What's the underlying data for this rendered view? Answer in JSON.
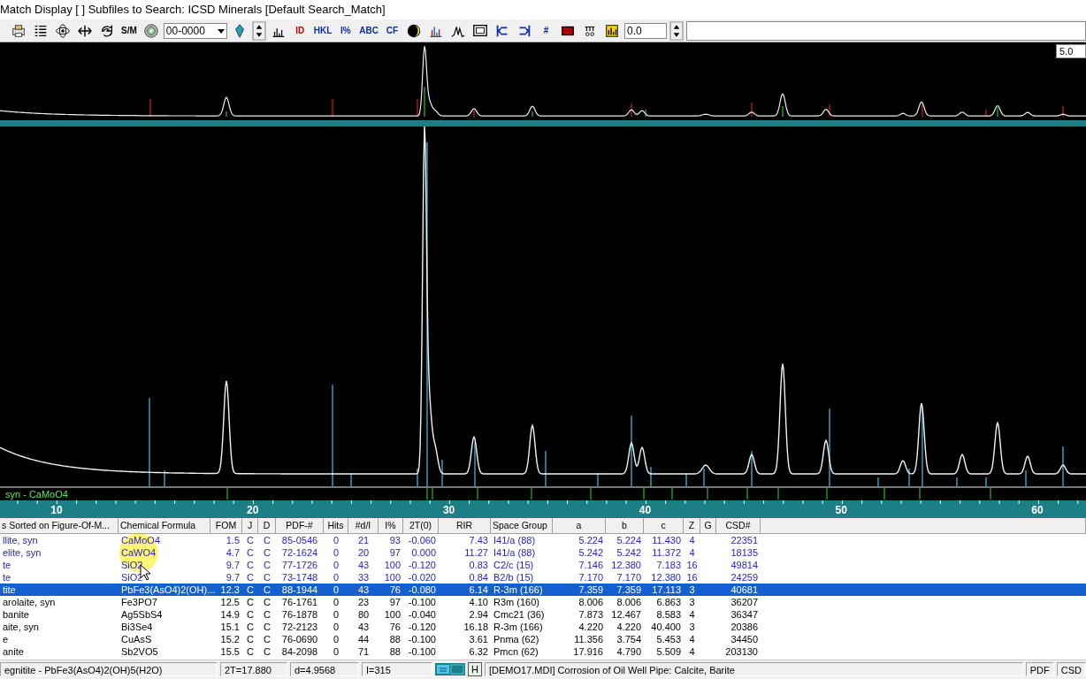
{
  "window": {
    "title": "Match Display [ ] Subfiles to Search: ICSD Minerals [Default Search_Match]"
  },
  "toolbar": {
    "items": [
      {
        "kind": "icon"
      },
      {
        "kind": "icon"
      },
      {
        "kind": "icon"
      },
      {
        "kind": "icon"
      },
      {
        "kind": "icon"
      },
      {
        "kind": "text",
        "label": "S/M"
      },
      {
        "kind": "icon"
      },
      {
        "kind": "combo",
        "value": "00-0000"
      },
      {
        "kind": "icon"
      },
      {
        "kind": "spin"
      },
      {
        "kind": "icon"
      },
      {
        "kind": "text",
        "label": "ID"
      },
      {
        "kind": "text",
        "label": "HKL"
      },
      {
        "kind": "text",
        "label": "I%"
      },
      {
        "kind": "text",
        "label": "ABC"
      },
      {
        "kind": "text",
        "label": "CF"
      },
      {
        "kind": "icon"
      },
      {
        "kind": "icon"
      },
      {
        "kind": "icon"
      },
      {
        "kind": "icon"
      },
      {
        "kind": "icon"
      },
      {
        "kind": "icon"
      },
      {
        "kind": "text",
        "label": "#"
      },
      {
        "kind": "icon"
      },
      {
        "kind": "icon"
      },
      {
        "kind": "icon"
      },
      {
        "kind": "field",
        "value": "0.0"
      },
      {
        "kind": "spin"
      },
      {
        "kind": "wide_field"
      }
    ]
  },
  "overview": {
    "scale": "5.0"
  },
  "pattern": {
    "phase_label": "syn - CaMoO4",
    "axis_labels": [
      "10",
      "20",
      "30",
      "40",
      "50",
      "60"
    ]
  },
  "table": {
    "columns": [
      "s Sorted on Figure-Of-M...",
      "Chemical Formula",
      "FOM",
      "J",
      "D",
      "PDF-#",
      "Hits",
      "#d/I",
      "I%",
      "2T(0)",
      "RIR",
      "Space Group",
      "a",
      "b",
      "c",
      "Z",
      "G",
      "CSD#"
    ],
    "rows": [
      {
        "selected": false,
        "matched": true,
        "cells": [
          "llite, syn",
          "CaMoO4",
          "1.5",
          "C",
          "C",
          "85-0546",
          "0",
          "21",
          "93",
          "-0.060",
          "7.43",
          "I41/a (88)",
          "5.224",
          "5.224",
          "11.430",
          "4",
          "",
          "22351"
        ]
      },
      {
        "selected": false,
        "matched": true,
        "cells": [
          "elite, syn",
          "CaWO4",
          "4.7",
          "C",
          "C",
          "72-1624",
          "0",
          "20",
          "97",
          "0.000",
          "11.27",
          "I41/a (88)",
          "5.242",
          "5.242",
          "11.372",
          "4",
          "",
          "18135"
        ]
      },
      {
        "selected": false,
        "matched": true,
        "cells": [
          "te",
          "SiO2",
          "9.7",
          "C",
          "C",
          "77-1726",
          "0",
          "43",
          "100",
          "-0.120",
          "0.83",
          "C2/c (15)",
          "7.146",
          "12.380",
          "7.183",
          "16",
          "",
          "49814"
        ]
      },
      {
        "selected": false,
        "matched": true,
        "cells": [
          "te",
          "SiO2",
          "9.7",
          "C",
          "C",
          "73-1748",
          "0",
          "33",
          "100",
          "-0.020",
          "0.84",
          "B2/b (15)",
          "7.170",
          "7.170",
          "12.380",
          "16",
          "",
          "24259"
        ]
      },
      {
        "selected": true,
        "matched": false,
        "cells": [
          "tite",
          "PbFe3(AsO4)2(OH)...",
          "12.3",
          "C",
          "C",
          "88-1944",
          "0",
          "43",
          "76",
          "-0.080",
          "6.14",
          "R-3m (166)",
          "7.359",
          "7.359",
          "17.113",
          "3",
          "",
          "40681"
        ]
      },
      {
        "selected": false,
        "matched": false,
        "cells": [
          "arolaite, syn",
          "Fe3PO7",
          "12.5",
          "C",
          "C",
          "76-1761",
          "0",
          "23",
          "97",
          "-0.100",
          "4.10",
          "R3m (160)",
          "8.006",
          "8.006",
          "6.863",
          "3",
          "",
          "36207"
        ]
      },
      {
        "selected": false,
        "matched": false,
        "cells": [
          "banite",
          "Ag5SbS4",
          "14.9",
          "C",
          "C",
          "76-1878",
          "0",
          "80",
          "100",
          "-0.040",
          "2.94",
          "Cmc21 (36)",
          "7.873",
          "12.467",
          "8.583",
          "4",
          "",
          "36347"
        ]
      },
      {
        "selected": false,
        "matched": false,
        "cells": [
          "aite, syn",
          "Bi3Se4",
          "15.1",
          "C",
          "C",
          "72-2123",
          "0",
          "43",
          "76",
          "-0.120",
          "16.18",
          "R-3m (166)",
          "4.220",
          "4.220",
          "40.400",
          "3",
          "",
          "20386"
        ]
      },
      {
        "selected": false,
        "matched": false,
        "cells": [
          "e",
          "CuAsS",
          "15.2",
          "C",
          "C",
          "76-0690",
          "0",
          "44",
          "88",
          "-0.100",
          "3.61",
          "Pnma (62)",
          "11.356",
          "3.754",
          "5.453",
          "4",
          "",
          "34450"
        ]
      },
      {
        "selected": false,
        "matched": false,
        "cells": [
          "anite",
          "Sb2VO5",
          "15.5",
          "C",
          "C",
          "84-2098",
          "0",
          "71",
          "88",
          "-0.100",
          "6.32",
          "Pmcn (62)",
          "17.916",
          "4.790",
          "5.509",
          "4",
          "",
          "203130"
        ]
      }
    ]
  },
  "status_bar": {
    "phase": "egnitite - PbFe3(AsO4)2(OH)5(H2O)",
    "two_theta": "2T=17.880",
    "d_spacing": "d=4.9568",
    "intensity": "I=315",
    "mode": "H",
    "document": "[DEMO17.MDI] Corrosion of Oil Well Pipe: Calcite, Barite",
    "badges": [
      "PDF",
      "CSD"
    ]
  }
}
